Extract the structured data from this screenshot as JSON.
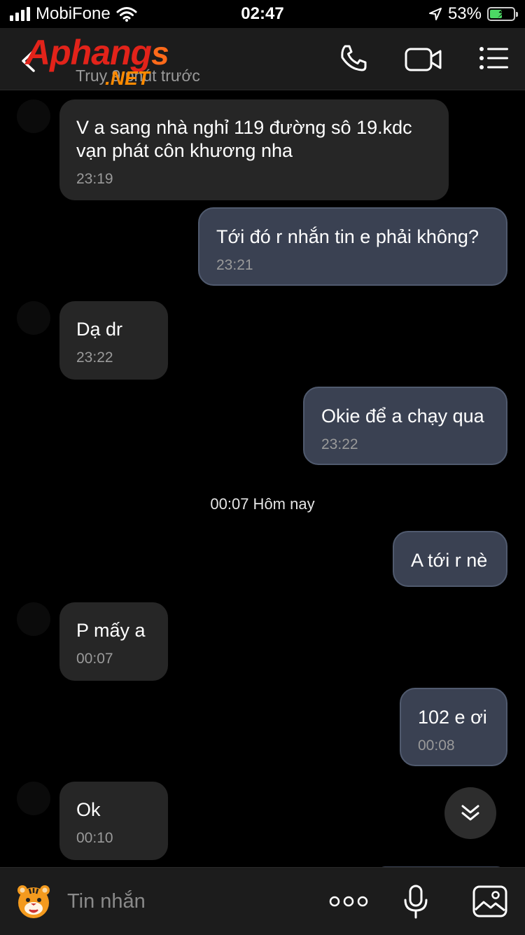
{
  "status_bar": {
    "carrier": "MobiFone",
    "time": "02:47",
    "battery_percent": "53%",
    "battery_level": 0.53
  },
  "header": {
    "brand_main": "Aphang",
    "brand_tail": "s",
    "brand_sub": ".NET",
    "subtitle": "Truy     9 phút trước",
    "icons": [
      "back-chevron",
      "phone-icon",
      "video-icon",
      "menu-icon"
    ]
  },
  "messages": [
    {
      "dir": "in",
      "text": "V a sang nhà nghỉ 119 đường sô 19.kdc vạn phát côn khương nha",
      "time": "23:19"
    },
    {
      "dir": "out",
      "text": "Tới đó r nhắn tin e phải không?",
      "time": "23:21"
    },
    {
      "dir": "in",
      "text": "Dạ dr",
      "time": "23:22"
    },
    {
      "dir": "out",
      "text": "Okie để a chạy qua",
      "time": "23:22"
    },
    {
      "dir": "divider",
      "text": "00:07 Hôm nay"
    },
    {
      "dir": "out",
      "text": "A tới r nè",
      "time": ""
    },
    {
      "dir": "in",
      "text": "P mấy a",
      "time": "00:07"
    },
    {
      "dir": "out",
      "text": "102 e ơi",
      "time": "00:08"
    },
    {
      "dir": "in",
      "text": "Ok",
      "time": "00:10"
    }
  ],
  "input": {
    "placeholder": "Tin nhắn"
  },
  "colors": {
    "background": "#000000",
    "incoming_bubble": "#262626",
    "outgoing_bubble": "#3a4152",
    "bar": "#1c1c1c"
  }
}
